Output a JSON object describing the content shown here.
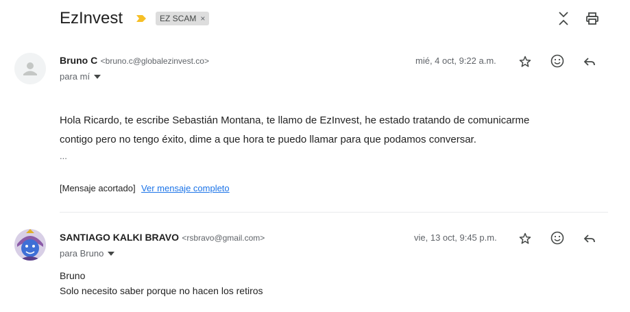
{
  "thread": {
    "subject": "EzInvest",
    "label": "EZ SCAM",
    "label_remove": "×"
  },
  "messages": [
    {
      "sender_name": "Bruno C",
      "sender_email": "<bruno.c@globalezinvest.co>",
      "recipient": "para mí",
      "date": "mié, 4 oct, 9:22 a.m.",
      "body_line1": "Hola Ricardo, te escribe Sebastián Montana, te llamo de EzInvest, he estado tratando de comunicarme",
      "body_line2": "contigo pero no tengo éxito, dime a que hora te puedo llamar para que podamos conversar.",
      "ellipsis": "...",
      "clipped_note": "[Mensaje acortado]",
      "view_full": "Ver mensaje completo"
    },
    {
      "sender_name": "SANTIAGO KALKI BRAVO",
      "sender_email": "<rsbravo@gmail.com>",
      "recipient": "para Bruno",
      "date": "vie, 13 oct, 9:45 p.m.",
      "body_line1": "Bruno",
      "body_line2": "Solo necesito saber porque no hacen los retiros"
    }
  ],
  "icons": {
    "important": "importance-marker-icon",
    "expand": "expand-all-icon",
    "print": "print-icon",
    "star": "star-icon",
    "emoji": "emoji-reaction-icon",
    "reply": "reply-icon",
    "avatar_default": "person-icon"
  },
  "colors": {
    "important_marker": "#f6bf26",
    "link": "#1a73e8",
    "chip_bg": "#dddddd"
  }
}
